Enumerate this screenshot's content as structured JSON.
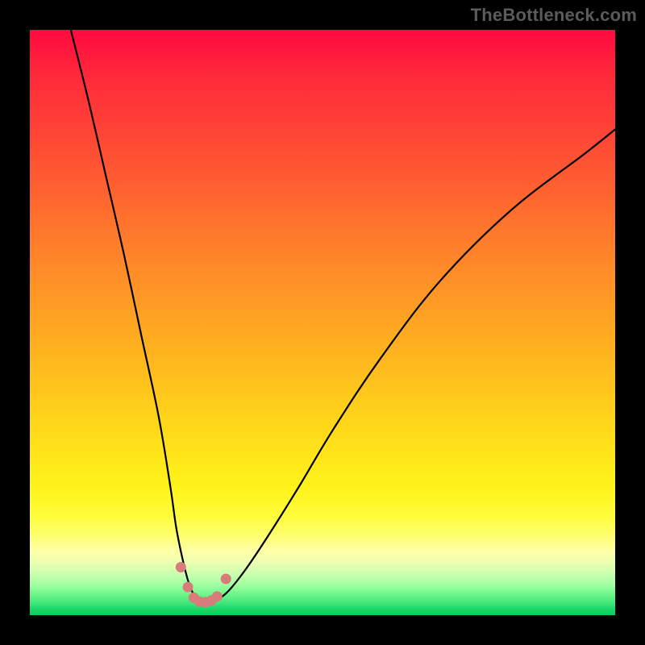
{
  "watermark": "TheBottleneck.com",
  "chart_data": {
    "type": "line",
    "title": "",
    "xlabel": "",
    "ylabel": "",
    "xlim": [
      0,
      100
    ],
    "ylim": [
      0,
      100
    ],
    "series": [
      {
        "name": "curve",
        "x": [
          7,
          10,
          13,
          16,
          19,
          22,
          24,
          25,
          26,
          27,
          28,
          29,
          30,
          31,
          32,
          34,
          37,
          41,
          46,
          52,
          60,
          70,
          82,
          95,
          100
        ],
        "y": [
          100,
          88,
          75,
          62,
          48,
          34,
          22,
          15,
          10,
          6,
          3.5,
          2.3,
          2.0,
          2.1,
          2.6,
          4.2,
          8,
          14,
          22,
          32,
          44,
          57,
          69,
          79,
          83
        ]
      }
    ],
    "markers": [
      {
        "x": 25.8,
        "y": 8.2
      },
      {
        "x": 27.0,
        "y": 4.8
      },
      {
        "x": 28.0,
        "y": 3.0
      },
      {
        "x": 29.0,
        "y": 2.3
      },
      {
        "x": 30.0,
        "y": 2.2
      },
      {
        "x": 31.0,
        "y": 2.5
      },
      {
        "x": 32.0,
        "y": 3.2
      },
      {
        "x": 33.5,
        "y": 6.2
      }
    ],
    "colors": {
      "curve": "#000000",
      "markers": "#d87b7b",
      "gradient_top": "#ff0a40",
      "gradient_bottom": "#0bce5e"
    }
  }
}
